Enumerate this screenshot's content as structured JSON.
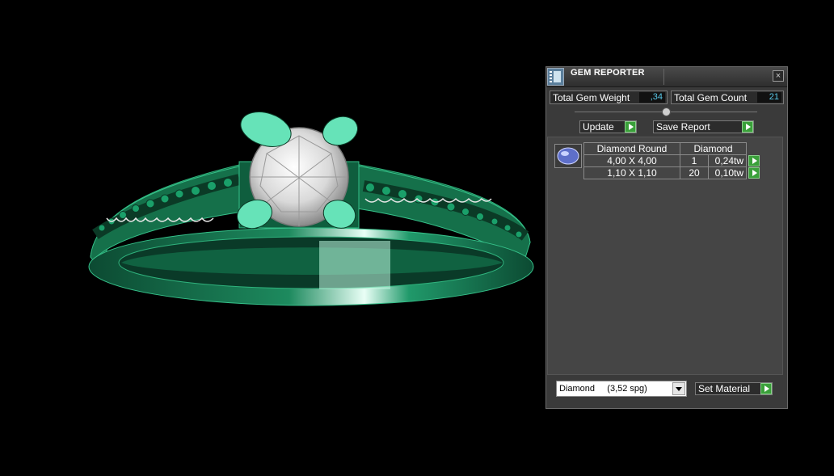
{
  "panel": {
    "title": "GEM REPORTER",
    "close_label": "×",
    "total_weight_label": "Total Gem Weight",
    "total_weight_value": ",34",
    "total_count_label": "Total Gem Count",
    "total_count_value": "21",
    "update_label": "Update",
    "save_report_label": "Save Report",
    "table": {
      "header": {
        "shape": "Diamond Round",
        "material": "Diamond"
      },
      "rows": [
        {
          "size": "4,00 X 4,00",
          "count": "1",
          "weight": "0,24tw"
        },
        {
          "size": "1,10 X 1,10",
          "count": "20",
          "weight": "0,10tw"
        }
      ]
    },
    "material_select": "Diamond     (3,52 spg)",
    "set_material_label": "Set Material"
  },
  "colors": {
    "ring_green": "#1a7a52",
    "prong_green": "#66e3b8",
    "accent_blue": "#59c8e8",
    "button_green": "#3aa03a"
  },
  "chart_data": {
    "type": "table",
    "columns": [
      "shape_name",
      "shape_type",
      "material"
    ],
    "rows": [
      [
        "4,00 X 4,00",
        "Diamond Round",
        "Diamond"
      ],
      [
        "4,00 X 4,00",
        "1",
        "0,24tw"
      ],
      [
        "1,10 X 1,10",
        "20",
        "0,10tw"
      ]
    ]
  }
}
